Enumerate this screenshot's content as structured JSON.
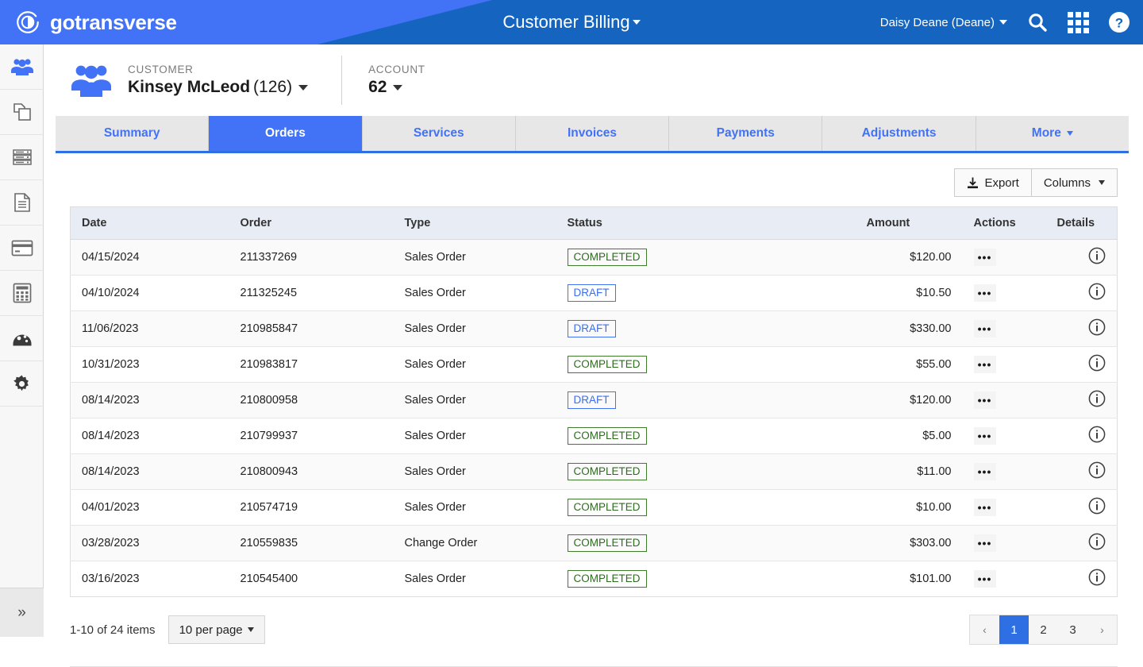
{
  "header": {
    "brand": "gotransverse",
    "brand_logo_icon": "gotransverse-circle-logo",
    "app_title": "Customer Billing",
    "app_title_caret_icon": "caret-down-icon",
    "user_name": "Daisy Deane (Deane)",
    "search_icon": "search-icon",
    "apps_icon": "grid-apps-icon",
    "help_icon": "help-circle-icon",
    "accent_blue": "#1565c0",
    "accent_light_blue": "#4272f5"
  },
  "sidebar": {
    "items": [
      {
        "icon": "customers-group-icon",
        "active": true
      },
      {
        "icon": "products-copy-icon",
        "active": false
      },
      {
        "icon": "rates-server-icon",
        "active": false
      },
      {
        "icon": "documents-page-icon",
        "active": false
      },
      {
        "icon": "payments-card-icon",
        "active": false
      },
      {
        "icon": "calculator-icon",
        "active": false
      },
      {
        "icon": "dashboard-gauge-icon",
        "active": false
      },
      {
        "icon": "settings-gear-icon",
        "active": false
      }
    ],
    "expand_label": "»",
    "expand_icon": "double-chevron-right-icon"
  },
  "context": {
    "avatar_icon": "customer-group-avatar-icon",
    "customer_label": "CUSTOMER",
    "customer_name": "Kinsey McLeod",
    "customer_id": "(126)",
    "account_label": "ACCOUNT",
    "account_value": "62"
  },
  "tabs": [
    {
      "label": "Summary",
      "active": false
    },
    {
      "label": "Orders",
      "active": true
    },
    {
      "label": "Services",
      "active": false
    },
    {
      "label": "Invoices",
      "active": false
    },
    {
      "label": "Payments",
      "active": false
    },
    {
      "label": "Adjustments",
      "active": false
    },
    {
      "label": "More",
      "active": false,
      "has_caret": true
    }
  ],
  "toolbar": {
    "export_label": "Export",
    "export_icon": "download-icon",
    "columns_label": "Columns",
    "columns_caret_icon": "caret-down-icon"
  },
  "table": {
    "columns": [
      "Date",
      "Order",
      "Type",
      "Status",
      "Amount",
      "Actions",
      "Details"
    ],
    "rows": [
      {
        "date": "04/15/2024",
        "order": "211337269",
        "type": "Sales Order",
        "status": "COMPLETED",
        "status_kind": "completed",
        "amount": "$120.00"
      },
      {
        "date": "04/10/2024",
        "order": "211325245",
        "type": "Sales Order",
        "status": "DRAFT",
        "status_kind": "draft",
        "amount": "$10.50"
      },
      {
        "date": "11/06/2023",
        "order": "210985847",
        "type": "Sales Order",
        "status": "DRAFT",
        "status_kind": "draft",
        "amount": "$330.00"
      },
      {
        "date": "10/31/2023",
        "order": "210983817",
        "type": "Sales Order",
        "status": "COMPLETED",
        "status_kind": "completed",
        "amount": "$55.00"
      },
      {
        "date": "08/14/2023",
        "order": "210800958",
        "type": "Sales Order",
        "status": "DRAFT",
        "status_kind": "draft",
        "amount": "$120.00"
      },
      {
        "date": "08/14/2023",
        "order": "210799937",
        "type": "Sales Order",
        "status": "COMPLETED",
        "status_kind": "completed",
        "amount": "$5.00"
      },
      {
        "date": "08/14/2023",
        "order": "210800943",
        "type": "Sales Order",
        "status": "COMPLETED",
        "status_kind": "completed",
        "amount": "$11.00"
      },
      {
        "date": "04/01/2023",
        "order": "210574719",
        "type": "Sales Order",
        "status": "COMPLETED",
        "status_kind": "completed",
        "amount": "$10.00"
      },
      {
        "date": "03/28/2023",
        "order": "210559835",
        "type": "Change Order",
        "status": "COMPLETED",
        "status_kind": "completed",
        "amount": "$303.00"
      },
      {
        "date": "03/16/2023",
        "order": "210545400",
        "type": "Sales Order",
        "status": "COMPLETED",
        "status_kind": "completed",
        "amount": "$101.00"
      }
    ],
    "action_glyph": "•••",
    "action_icon": "ellipsis-actions-icon",
    "details_icon": "info-circle-icon"
  },
  "pagination": {
    "count_text": "1-10 of 24 items",
    "per_page_label": "10 per page",
    "per_page_caret_icon": "caret-down-icon",
    "prev_glyph": "‹",
    "next_glyph": "›",
    "pages": [
      "1",
      "2",
      "3"
    ],
    "active_page": "1"
  }
}
